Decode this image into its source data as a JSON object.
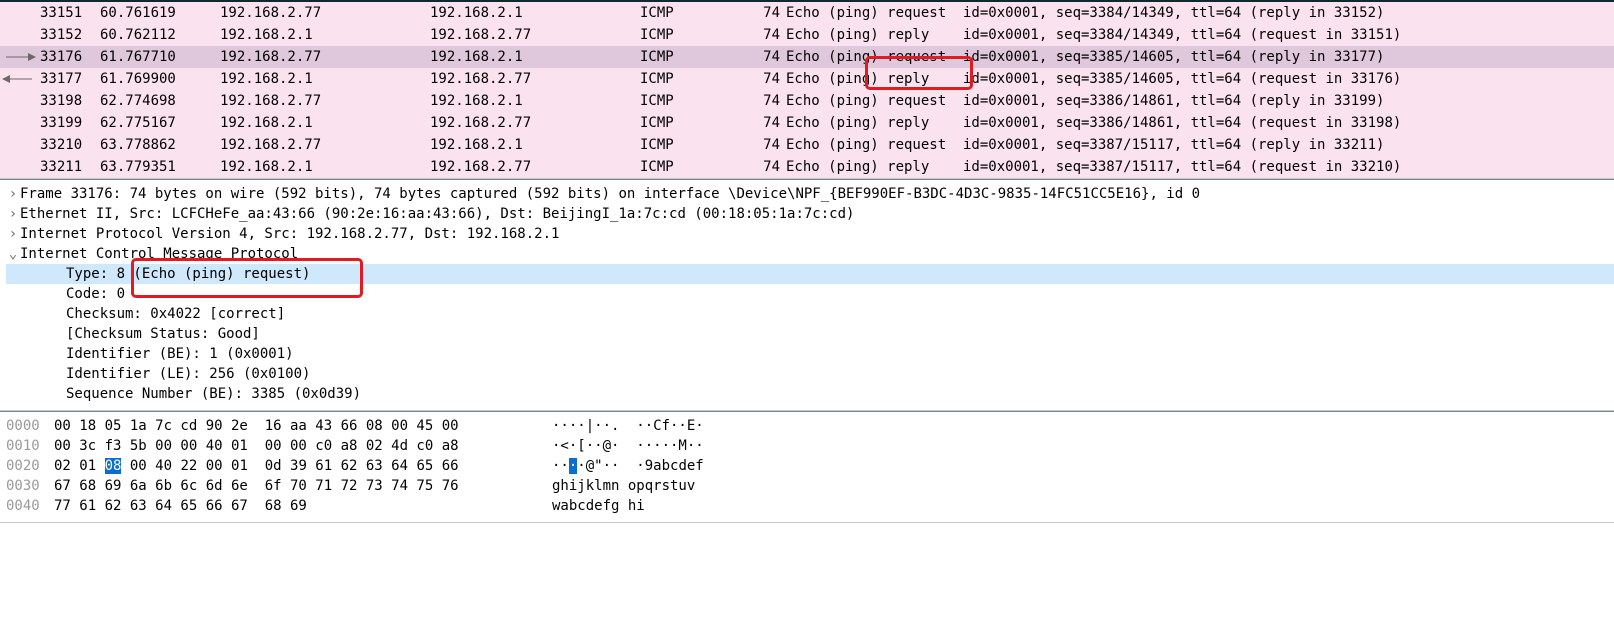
{
  "packets": [
    {
      "no": "33151",
      "time": "60.761619",
      "src": "192.168.2.77",
      "dst": "192.168.2.1",
      "proto": "ICMP",
      "len": "74",
      "info": "Echo (ping) request  id=0x0001, seq=3384/14349, ttl=64 (reply in 33152)",
      "sel": false,
      "arrow": ""
    },
    {
      "no": "33152",
      "time": "60.762112",
      "src": "192.168.2.1",
      "dst": "192.168.2.77",
      "proto": "ICMP",
      "len": "74",
      "info": "Echo (ping) reply    id=0x0001, seq=3384/14349, ttl=64 (request in 33151)",
      "sel": false,
      "arrow": ""
    },
    {
      "no": "33176",
      "time": "61.767710",
      "src": "192.168.2.77",
      "dst": "192.168.2.1",
      "proto": "ICMP",
      "len": "74",
      "info": "Echo (ping) request  id=0x0001, seq=3385/14605, ttl=64 (reply in 33177)",
      "sel": true,
      "arrow": "right"
    },
    {
      "no": "33177",
      "time": "61.769900",
      "src": "192.168.2.1",
      "dst": "192.168.2.77",
      "proto": "ICMP",
      "len": "74",
      "info": "Echo (ping) reply    id=0x0001, seq=3385/14605, ttl=64 (request in 33176)",
      "sel": false,
      "arrow": "left"
    },
    {
      "no": "33198",
      "time": "62.774698",
      "src": "192.168.2.77",
      "dst": "192.168.2.1",
      "proto": "ICMP",
      "len": "74",
      "info": "Echo (ping) request  id=0x0001, seq=3386/14861, ttl=64 (reply in 33199)",
      "sel": false,
      "arrow": ""
    },
    {
      "no": "33199",
      "time": "62.775167",
      "src": "192.168.2.1",
      "dst": "192.168.2.77",
      "proto": "ICMP",
      "len": "74",
      "info": "Echo (ping) reply    id=0x0001, seq=3386/14861, ttl=64 (request in 33198)",
      "sel": false,
      "arrow": ""
    },
    {
      "no": "33210",
      "time": "63.778862",
      "src": "192.168.2.77",
      "dst": "192.168.2.1",
      "proto": "ICMP",
      "len": "74",
      "info": "Echo (ping) request  id=0x0001, seq=3387/15117, ttl=64 (reply in 33211)",
      "sel": false,
      "arrow": ""
    },
    {
      "no": "33211",
      "time": "63.779351",
      "src": "192.168.2.1",
      "dst": "192.168.2.77",
      "proto": "ICMP",
      "len": "74",
      "info": "Echo (ping) reply    id=0x0001, seq=3387/15117, ttl=64 (request in 33210)",
      "sel": false,
      "arrow": ""
    }
  ],
  "details": {
    "frame": "Frame 33176: 74 bytes on wire (592 bits), 74 bytes captured (592 bits) on interface \\Device\\NPF_{BEF990EF-B3DC-4D3C-9835-14FC51CC5E16}, id 0",
    "eth": "Ethernet II, Src: LCFCHeFe_aa:43:66 (90:2e:16:aa:43:66), Dst: BeijingI_1a:7c:cd (00:18:05:1a:7c:cd)",
    "ip": "Internet Protocol Version 4, Src: 192.168.2.77, Dst: 192.168.2.1",
    "icmp": "Internet Control Message Protocol",
    "type": "Type: 8 (Echo (ping) request)",
    "code": "Code: 0",
    "checksum": "Checksum: 0x4022 [correct]",
    "ckstatus": "[Checksum Status: Good]",
    "id_be": "Identifier (BE): 1 (0x0001)",
    "id_le": "Identifier (LE): 256 (0x0100)",
    "seq_be": "Sequence Number (BE): 3385 (0x0d39)"
  },
  "hex": [
    {
      "off": "0000",
      "b": "00 18 05 1a 7c cd 90 2e  16 aa 43 66 08 00 45 00",
      "a": "····|··.  ··Cf··E·"
    },
    {
      "off": "0010",
      "b": "00 3c f3 5b 00 00 40 01  00 00 c0 a8 02 4d c0 a8",
      "a": "·<·[··@·  ·····M··"
    },
    {
      "off": "0020",
      "b": "02 01 |08| 00 40 22 00 01  0d 39 61 62 63 64 65 66",
      "a": "··|·|·@\"··  ·9abcdef"
    },
    {
      "off": "0030",
      "b": "67 68 69 6a 6b 6c 6d 6e  6f 70 71 72 73 74 75 76",
      "a": "ghijklmn opqrstuv"
    },
    {
      "off": "0040",
      "b": "77 61 62 63 64 65 66 67  68 69",
      "a": "wabcdefg hi"
    }
  ]
}
